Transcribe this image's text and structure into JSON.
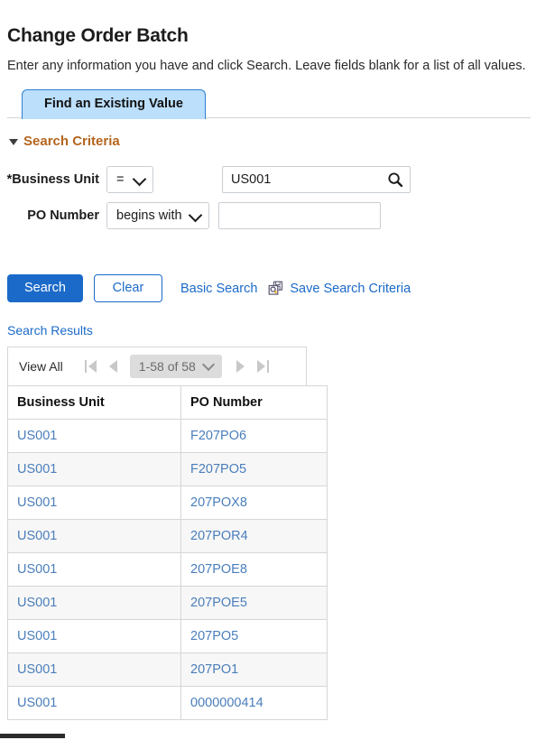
{
  "page": {
    "title": "Change Order Batch",
    "instructions": "Enter any information you have and click Search. Leave fields blank for a list of all values."
  },
  "tabs": [
    {
      "label": "Find an Existing Value",
      "active": true
    }
  ],
  "search_criteria": {
    "section_label": "Search Criteria",
    "fields": [
      {
        "label": "*Business Unit",
        "operator": "=",
        "value": "US001",
        "placeholder": "",
        "has_lookup": true
      },
      {
        "label": "PO Number",
        "operator": "begins with",
        "value": "",
        "placeholder": "",
        "has_lookup": false
      }
    ]
  },
  "actions": {
    "search_label": "Search",
    "clear_label": "Clear",
    "basic_search_label": "Basic Search",
    "save_search_label": "Save Search Criteria",
    "save_icon": "save-search-icon"
  },
  "results": {
    "label": "Search Results",
    "pager": {
      "view_all_label": "View All",
      "range_label": "1-58 of 58",
      "first_icon": "first-page-icon",
      "prev_icon": "previous-page-icon",
      "next_icon": "next-page-icon",
      "last_icon": "last-page-icon"
    },
    "columns": [
      "Business Unit",
      "PO Number"
    ],
    "rows": [
      {
        "business_unit": "US001",
        "po_number": "F207PO6"
      },
      {
        "business_unit": "US001",
        "po_number": "F207PO5"
      },
      {
        "business_unit": "US001",
        "po_number": "207POX8"
      },
      {
        "business_unit": "US001",
        "po_number": "207POR4"
      },
      {
        "business_unit": "US001",
        "po_number": "207POE8"
      },
      {
        "business_unit": "US001",
        "po_number": "207POE5"
      },
      {
        "business_unit": "US001",
        "po_number": "207PO5"
      },
      {
        "business_unit": "US001",
        "po_number": "207PO1"
      },
      {
        "business_unit": "US001",
        "po_number": "0000000414"
      }
    ]
  },
  "colors": {
    "accent_blue": "#1b6ac9",
    "link_blue": "#4a7ebb",
    "tab_blue": "#bcdffb",
    "section_orange": "#b5651d"
  }
}
